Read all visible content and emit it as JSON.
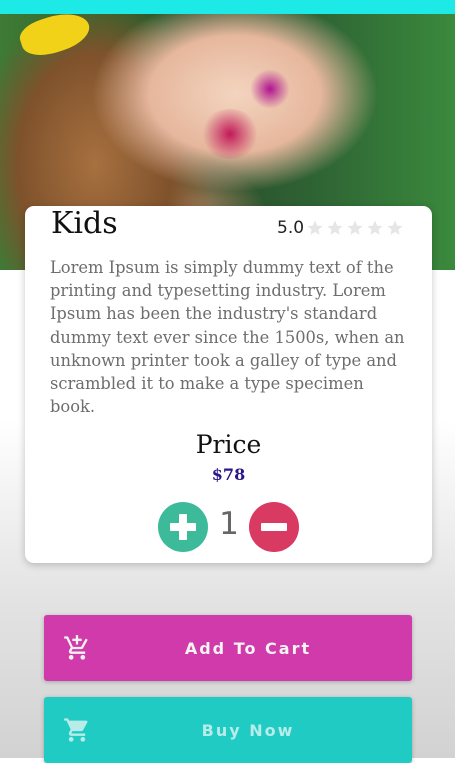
{
  "product": {
    "title": "Kids",
    "rating": "5.0",
    "stars_filled": 0,
    "stars_total": 5,
    "description": "Lorem Ipsum is simply dummy text of the printing and typesetting industry. Lorem Ipsum has been the industry's standard dummy text ever since the 1500s, when an unknown printer took a galley of type and scrambled it to make a type specimen book.",
    "price_label": "Price",
    "price": "$78",
    "quantity": "1"
  },
  "actions": {
    "add_to_cart_label": "Add To Cart",
    "buy_now_label": "Buy Now"
  },
  "icons": {
    "plus": "plus-icon",
    "minus": "minus-icon",
    "star": "star-icon",
    "add_cart": "add-shopping-cart-icon",
    "cart": "shopping-cart-icon"
  },
  "colors": {
    "status_bar": "#1de9e6",
    "plus_button": "#3dba9a",
    "minus_button": "#d83a61",
    "price": "#2a168a",
    "add_to_cart": "#d03aaa",
    "buy_now": "#20cbc4",
    "star_empty": "#e6e6e6"
  }
}
